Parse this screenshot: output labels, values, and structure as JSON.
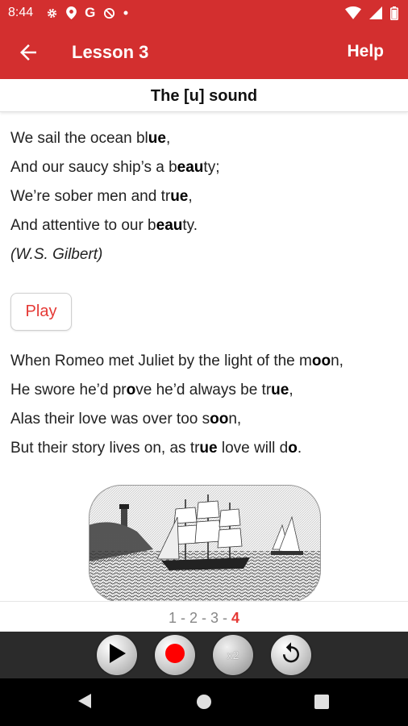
{
  "status_bar": {
    "time": "8:44",
    "left_icons": [
      "gear-icon",
      "location-icon",
      "google-icon",
      "no-signal-icon",
      "dot-icon"
    ],
    "right_icons": [
      "wifi-icon",
      "signal-icon",
      "battery-icon"
    ],
    "google_letter": "G"
  },
  "app_bar": {
    "title": "Lesson 3",
    "help": "Help",
    "color": "#d32f2f"
  },
  "subheader": {
    "title": "The [u] sound"
  },
  "poem1": {
    "lines": [
      [
        {
          "t": "We sail the ocean bl"
        },
        {
          "t": "ue",
          "b": true
        },
        {
          "t": ","
        }
      ],
      [
        {
          "t": "And our saucy ship’s a b"
        },
        {
          "t": "eau",
          "b": true
        },
        {
          "t": "ty;"
        }
      ],
      [
        {
          "t": "We’re sober men and tr"
        },
        {
          "t": "ue",
          "b": true
        },
        {
          "t": ","
        }
      ],
      [
        {
          "t": "And attentive to our b"
        },
        {
          "t": "eau",
          "b": true
        },
        {
          "t": "ty."
        }
      ]
    ],
    "author": "(W.S. Gilbert)"
  },
  "play_button": {
    "label": "Play"
  },
  "poem2": {
    "lines": [
      [
        {
          "t": "When Romeo met Juliet by the light of the m"
        },
        {
          "t": "oo",
          "b": true
        },
        {
          "t": "n,"
        }
      ],
      [
        {
          "t": "He swore he’d pr"
        },
        {
          "t": "o",
          "b": true
        },
        {
          "t": "ve he’d always be tr"
        },
        {
          "t": "ue",
          "b": true
        },
        {
          "t": ","
        }
      ],
      [
        {
          "t": "Alas their love was over too s"
        },
        {
          "t": "oo",
          "b": true
        },
        {
          "t": "n,"
        }
      ],
      [
        {
          "t": "But their story lives on, as tr"
        },
        {
          "t": "ue",
          "b": true
        },
        {
          "t": " love will d"
        },
        {
          "t": "o",
          "b": true
        },
        {
          "t": "."
        }
      ]
    ]
  },
  "pager": {
    "pages": [
      "1",
      "2",
      "3",
      "4"
    ],
    "separator": " - ",
    "active_index": 3
  },
  "controls": {
    "buttons": [
      "play-icon",
      "record-icon",
      "speed-x2-icon",
      "replay-icon"
    ],
    "x2_label": "x2",
    "record_color": "#ff0000"
  },
  "nav_bar": {
    "icons": [
      "back-icon",
      "home-icon",
      "recents-icon"
    ]
  }
}
